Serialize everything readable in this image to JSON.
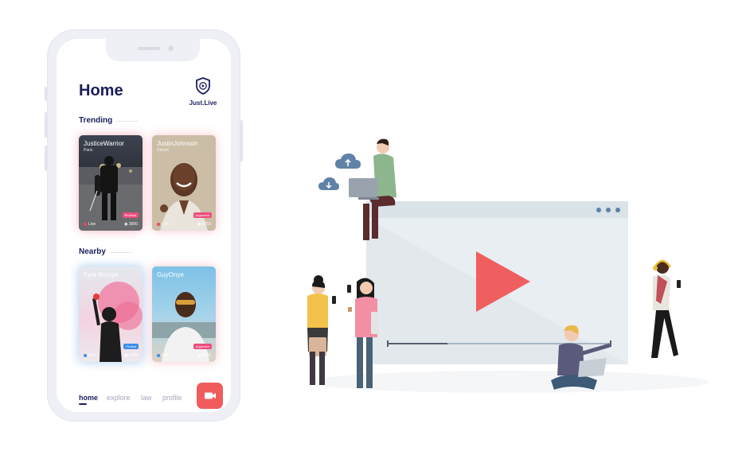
{
  "app": {
    "title": "Home",
    "logo_text": "Just.Live"
  },
  "sections": {
    "trending": "Trending",
    "nearby": "Nearby"
  },
  "cards": {
    "trending": [
      {
        "name": "JusticeWarrior",
        "location": "Paris",
        "tag": "Riot/Nat",
        "status": "Live",
        "views": "3000"
      },
      {
        "name": "JustinJohnson",
        "location": "Detroit",
        "tag": "Argument",
        "status": "Live",
        "views": "3753"
      }
    ],
    "nearby": [
      {
        "name": "Fyre Rumpe",
        "location": "",
        "tag": "Protest",
        "status": "Rec",
        "views": "4788"
      },
      {
        "name": "GuyOnye",
        "location": "",
        "tag": "Argument",
        "status": "Rec",
        "views": "3991"
      }
    ]
  },
  "nav": {
    "items": [
      "home",
      "explore",
      "law",
      "profile"
    ],
    "active": "home"
  },
  "colors": {
    "brand_navy": "#1b1f5c",
    "accent_red": "#f05c5c",
    "tag_pink": "#ee4d7d",
    "tag_blue": "#3b8ee8",
    "cloud_blue": "#5f82a6",
    "play_red": "#ef5f5f"
  },
  "icons": {
    "logo": "shield-play-icon",
    "record": "video-camera-icon",
    "views": "eye-icon",
    "play": "play-icon",
    "cloud_upload": "cloud-upload-icon",
    "cloud_download": "cloud-download-icon"
  },
  "video": {
    "progress": 0.27
  }
}
